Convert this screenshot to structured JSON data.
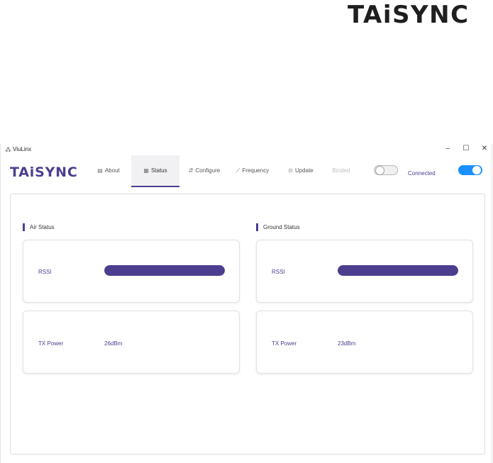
{
  "brand": {
    "logo_text": "TAiSYNC"
  },
  "window": {
    "title": "ViuLinx",
    "controls": {
      "minimize": "–",
      "maximize": "☐",
      "close": "✕"
    }
  },
  "nav": {
    "logo_text": "TAiSYNC",
    "tabs": [
      {
        "label": "About",
        "icon": "info-card-icon",
        "glyph": "▤"
      },
      {
        "label": "Status",
        "icon": "status-table-icon",
        "glyph": "▦",
        "active": true
      },
      {
        "label": "Configure",
        "icon": "sliders-icon",
        "glyph": "⇵"
      },
      {
        "label": "Frequency",
        "icon": "line-chart-icon",
        "glyph": "⟋"
      },
      {
        "label": "Update",
        "icon": "update-icon",
        "glyph": "⊙"
      },
      {
        "label": "Binded",
        "icon": "bind-icon",
        "disabled": true
      }
    ],
    "bind_toggle": {
      "on": false
    },
    "connected_label": "Connected",
    "connected_toggle": {
      "on": true,
      "color": "#1890ff"
    }
  },
  "main": {
    "air": {
      "title": "Air Status",
      "rssi_label": "RSSI",
      "rssi_fill": 1.0,
      "tx_label": "TX Power",
      "tx_value": "26dBm"
    },
    "ground": {
      "title": "Ground Status",
      "rssi_label": "RSSI",
      "rssi_fill": 1.0,
      "tx_label": "TX Power",
      "tx_value": "23dBm"
    }
  },
  "colors": {
    "accent": "#4d3d8f",
    "toggle_on": "#1890ff"
  }
}
